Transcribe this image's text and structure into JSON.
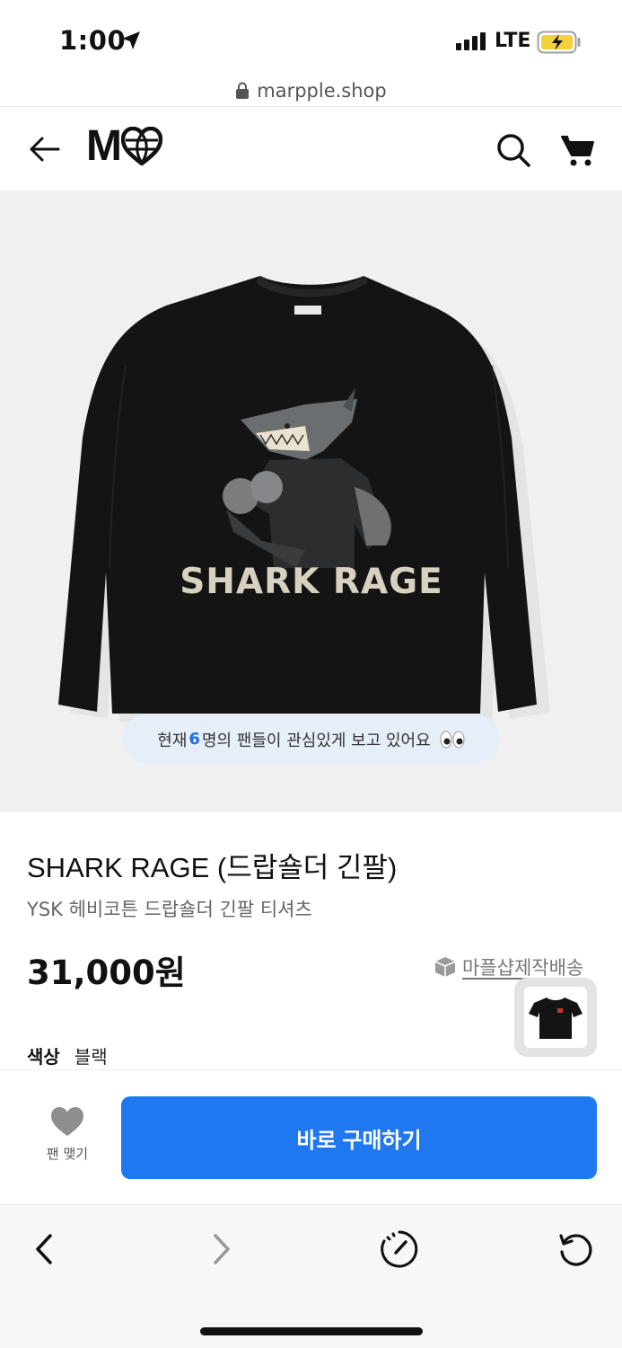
{
  "status": {
    "time": "1:00",
    "network": "LTE",
    "location_icon": "location-arrow-icon",
    "battery_icon": "battery-charging-icon"
  },
  "browser": {
    "url": "marpple.shop",
    "lock_icon": "lock-icon"
  },
  "header": {
    "logo_text": "M",
    "logo_icon": "heart-globe-icon",
    "back_icon": "back-arrow-icon",
    "search_icon": "search-icon",
    "cart_icon": "cart-icon"
  },
  "hero": {
    "print_text": "SHARK RAGE",
    "viewers_prefix": "현재 ",
    "viewers_count": "6",
    "viewers_suffix": "명의 팬들이 관심있게 보고 있어요",
    "eyes_icon": "eyes-emoji"
  },
  "product": {
    "title": "SHARK RAGE (드랍숄더 긴팔)",
    "subtitle": "YSK 헤비코튼 드랍숄더 긴팔 티셔츠",
    "price": "31,000원",
    "shipping_label": "마플샵제작배송",
    "color_label": "색상",
    "color_value": "블랙"
  },
  "actions": {
    "fan_label": "팬 맺기",
    "buy_label": "바로 구매하기"
  },
  "colors": {
    "accent": "#1f78f0",
    "viewer_count": "#1a6fe8",
    "hero_bg": "#f0f0f0",
    "shirt": "#141414"
  }
}
